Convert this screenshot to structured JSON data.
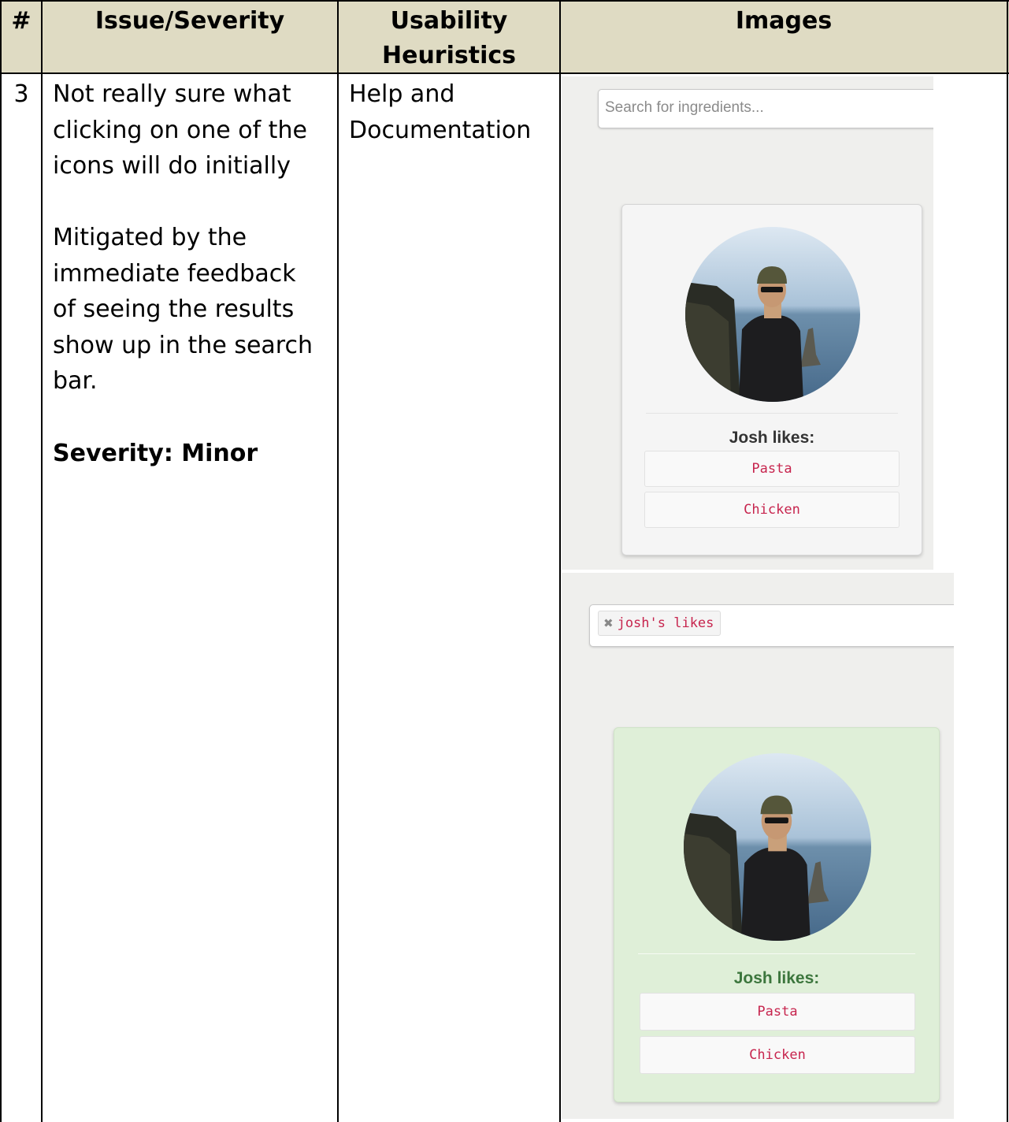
{
  "header": {
    "num": "#",
    "issue": "Issue/Severity",
    "heuristics_line1": "Usability",
    "heuristics_line2": "Heuristics",
    "images": "Images"
  },
  "row": {
    "num": "3",
    "issue_lines": [
      "Not really sure what",
      "clicking on one of the",
      "icons will do initially"
    ],
    "mitigation_lines": [
      "Mitigated by the",
      "immediate feedback",
      "of seeing the results",
      "show up in the search",
      "bar."
    ],
    "severity": "Severity: Minor",
    "heuristic_lines": [
      "Help and",
      "Documentation"
    ]
  },
  "screenshot_before": {
    "search_placeholder": "Search for ingredients...",
    "likes_title": "Josh likes:",
    "likes": [
      "Pasta",
      "Chicken"
    ]
  },
  "screenshot_after": {
    "tag_label": "josh's likes",
    "likes_title": "Josh likes:",
    "likes": [
      "Pasta",
      "Chicken"
    ]
  },
  "colors": {
    "header_bg": "#dfdbc3",
    "highlight_card": "#dfefd8",
    "likes_title_active": "#3c763d",
    "code_pink": "#c7254e"
  }
}
